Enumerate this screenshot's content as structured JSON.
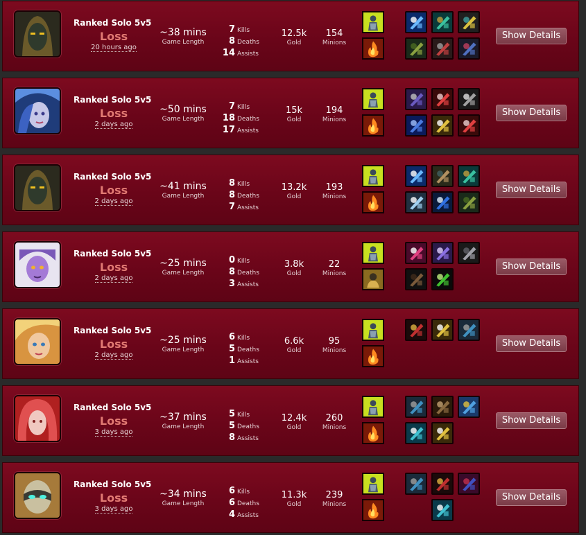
{
  "labels": {
    "game_length": "Game Length",
    "kills": "Kills",
    "deaths": "Deaths",
    "assists": "Assists",
    "gold": "Gold",
    "minions": "Minions",
    "show_details": "Show Details"
  },
  "matches": [
    {
      "champion_icon": "hooded-dark-champion-portrait",
      "queue": "Ranked Solo 5v5",
      "result": "Loss",
      "ago": "20 hours ago",
      "length": "~38 mins",
      "kills": "7",
      "deaths": "8",
      "assists": "14",
      "gold": "12.5k",
      "minions": "154",
      "spells": [
        "ghost-icon",
        "ignite-icon"
      ],
      "items": [
        "blue-blade-icon",
        "green-armor-icon",
        "yellow-boots-icon",
        "thornmail-icon",
        "red-gauntlet-icon",
        "blue-orb-icon"
      ]
    },
    {
      "champion_icon": "blue-haired-champion-portrait",
      "queue": "Ranked Solo 5v5",
      "result": "Loss",
      "ago": "2 days ago",
      "length": "~50 mins",
      "kills": "7",
      "deaths": "18",
      "assists": "17",
      "gold": "15k",
      "minions": "194",
      "spells": [
        "ghost-icon",
        "ignite-icon"
      ],
      "items": [
        "crossed-blades-icon",
        "red-sword-icon",
        "steel-helm-icon",
        "blue-shield-icon",
        "golden-spear-icon",
        "red-sword-icon"
      ]
    },
    {
      "champion_icon": "hooded-dark-champion-portrait",
      "queue": "Ranked Solo 5v5",
      "result": "Loss",
      "ago": "2 days ago",
      "length": "~41 mins",
      "kills": "8",
      "deaths": "8",
      "assists": "7",
      "gold": "13.2k",
      "minions": "193",
      "spells": [
        "ghost-icon",
        "ignite-icon"
      ],
      "items": [
        "blue-blade-icon",
        "bronze-gauntlet-icon",
        "green-armor-icon",
        "ice-crystal-icon",
        "blue-dagger-icon",
        "thornmail-icon"
      ]
    },
    {
      "champion_icon": "purple-champion-portrait",
      "queue": "Ranked Solo 5v5",
      "result": "Loss",
      "ago": "2 days ago",
      "length": "~25 mins",
      "kills": "0",
      "deaths": "8",
      "assists": "3",
      "gold": "3.8k",
      "minions": "22",
      "spells": [
        "ghost-icon",
        "exhaust-icon"
      ],
      "items": [
        "pink-eye-icon",
        "blue-swirl-icon",
        "silver-chestplate-icon",
        "brown-boots-icon",
        "green-potion-icon"
      ]
    },
    {
      "champion_icon": "blonde-champion-portrait",
      "queue": "Ranked Solo 5v5",
      "result": "Loss",
      "ago": "2 days ago",
      "length": "~25 mins",
      "kills": "6",
      "deaths": "5",
      "assists": "1",
      "gold": "6.6k",
      "minions": "95",
      "spells": [
        "ghost-icon",
        "ignite-icon"
      ],
      "items": [
        "red-ring-icon",
        "golden-spear-icon",
        "blue-hammer-icon"
      ]
    },
    {
      "champion_icon": "red-haired-champion-portrait",
      "queue": "Ranked Solo 5v5",
      "result": "Loss",
      "ago": "3 days ago",
      "length": "~37 mins",
      "kills": "5",
      "deaths": "5",
      "assists": "8",
      "gold": "12.4k",
      "minions": "260",
      "spells": [
        "ghost-icon",
        "ignite-icon"
      ],
      "items": [
        "blue-hammer-icon",
        "brown-tome-icon",
        "blue-wand-icon",
        "cyan-mask-icon",
        "golden-spear-icon"
      ]
    },
    {
      "champion_icon": "masked-champion-portrait",
      "queue": "Ranked Solo 5v5",
      "result": "Loss",
      "ago": "3 days ago",
      "length": "~34 mins",
      "kills": "6",
      "deaths": "6",
      "assists": "4",
      "gold": "11.3k",
      "minions": "239",
      "spells": [
        "ghost-icon",
        "ignite-icon"
      ],
      "items": [
        "blue-hammer-icon",
        "red-ring-icon",
        "wizard-hat-icon",
        "cyan-mask-icon"
      ]
    }
  ]
}
